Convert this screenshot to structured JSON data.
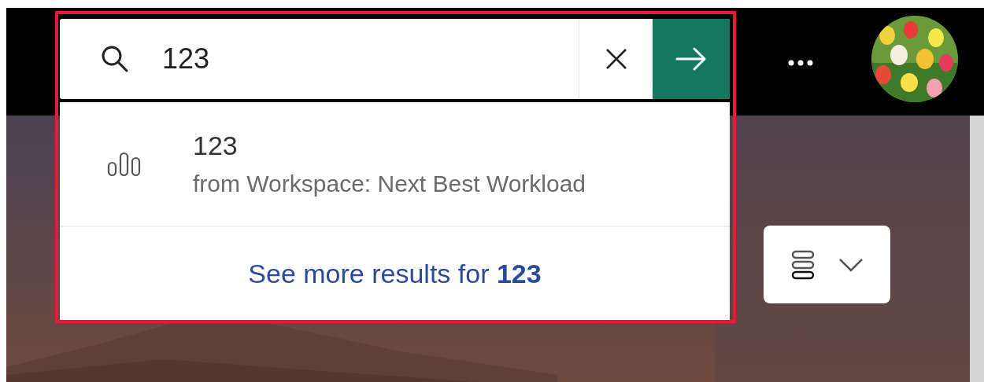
{
  "search": {
    "value": "123"
  },
  "suggestions": [
    {
      "title": "123",
      "subtitle": "from Workspace: Next Best Workload"
    }
  ],
  "see_more": "See more results for **123**"
}
